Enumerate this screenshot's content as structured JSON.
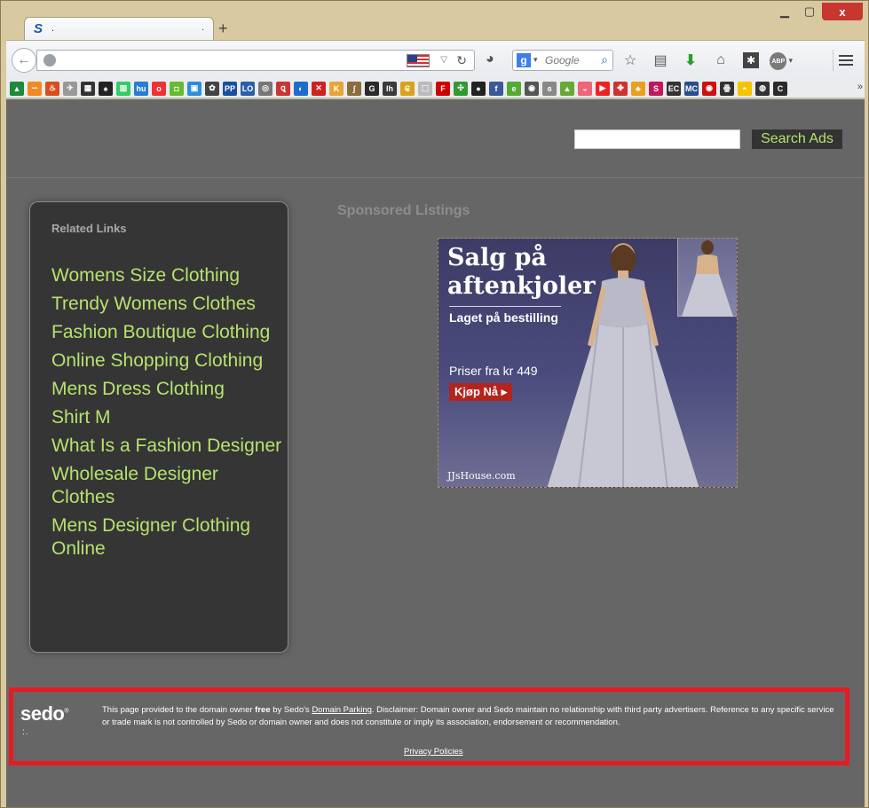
{
  "browser": {
    "tab_title": ".",
    "search_placeholder": "Google",
    "window_close": "x",
    "new_tab": "+",
    "abp_label": "ABP"
  },
  "page": {
    "search_button": "Search Ads",
    "related": {
      "title": "Related Links",
      "links": [
        "Womens Size Clothing",
        "Trendy Womens Clothes",
        "Fashion Boutique Clothing",
        "Online Shopping Clothing",
        "Mens Dress Clothing",
        "Shirt M",
        "What Is a Fashion Designer",
        "Wholesale Designer Clothes",
        "Mens Designer Clothing Online"
      ]
    },
    "sponsored_title": "Sponsored Listings",
    "ad": {
      "headline": "Salg på aftenkjoler",
      "subline": "Laget på bestilling",
      "price": "Priser fra kr 449",
      "cta": "Kjøp Nå ▸",
      "brand": "JJsHouse.com"
    },
    "footer": {
      "logo": "sedo",
      "text_pre": "This page provided to the domain owner ",
      "text_free": "free",
      "text_mid": " by Sedo's ",
      "domain_parking": "Domain Parking",
      "text_post": ". Disclaimer: Domain owner and Sedo maintain no relationship with third party advertisers. Reference to any specific service or trade mark is not controlled by Sedo or domain owner and does not constitute or imply its association, endorsement or recommendation.",
      "privacy": "Privacy Policies"
    }
  },
  "colors": {
    "link_green": "#b5e26e",
    "page_bg": "#666666",
    "footer_border": "#e81b23"
  }
}
